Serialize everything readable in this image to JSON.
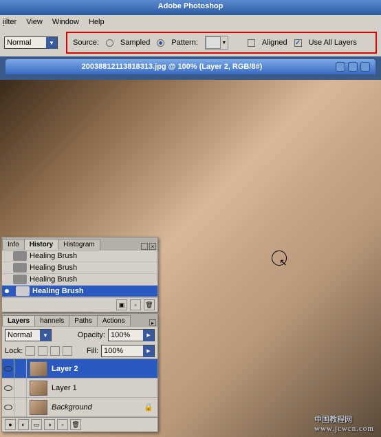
{
  "app_title": "Adobe Photoshop",
  "menubar": {
    "filter": "ilter",
    "view": "View",
    "window": "Window",
    "help": "Help"
  },
  "options": {
    "mode_label": "Normal",
    "source_label": "Source:",
    "sampled_label": "Sampled",
    "pattern_label": "Pattern:",
    "aligned_label": "Aligned",
    "use_all_layers_label": "Use All Layers"
  },
  "document_title": "20038812113818313.jpg @ 100% (Layer 2, RGB/8#)",
  "history_panel": {
    "tabs": {
      "info": "Info",
      "history": "History",
      "histogram": "Histogram"
    },
    "items": [
      "Healing Brush",
      "Healing Brush",
      "Healing Brush",
      "Healing Brush"
    ]
  },
  "layers_panel": {
    "tabs": {
      "layers": "Layers",
      "channels": "hannels",
      "paths": "Paths",
      "actions": "Actions"
    },
    "blend_mode": "Normal",
    "opacity_label": "Opacity:",
    "opacity_value": "100%",
    "lock_label": "Lock:",
    "fill_label": "Fill:",
    "fill_value": "100%",
    "layers": [
      {
        "name": "Layer 2",
        "italic": false
      },
      {
        "name": "Layer 1",
        "italic": false
      },
      {
        "name": "Background",
        "italic": true
      }
    ]
  },
  "watermark": {
    "text": "中国教程网",
    "url": "www.jcwcn.com"
  }
}
